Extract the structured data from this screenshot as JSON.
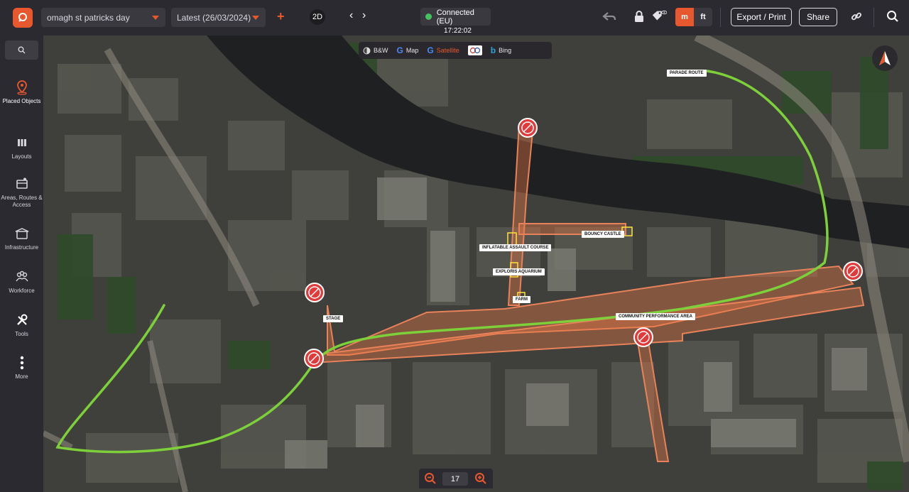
{
  "header": {
    "project_select": "omagh st patricks day",
    "version_select": "Latest (26/03/2024)",
    "view_mode": "2D",
    "connection_status": "Connected (EU)",
    "clock": "17:22:02",
    "unit_metric": "m",
    "unit_imperial": "ft",
    "export_label": "Export / Print",
    "share_label": "Share"
  },
  "sidebar": {
    "items": [
      {
        "label": "Placed Objects",
        "icon": "location-pin-icon"
      },
      {
        "label": "Layouts",
        "icon": "columns-icon"
      },
      {
        "label": "Areas, Routes & Access",
        "icon": "map-area-icon"
      },
      {
        "label": "Infrastructure",
        "icon": "tent-icon"
      },
      {
        "label": "Workforce",
        "icon": "people-icon"
      },
      {
        "label": "Tools",
        "icon": "wrench-icon"
      },
      {
        "label": "More",
        "icon": "more-dots-icon"
      }
    ]
  },
  "map": {
    "base_layers": [
      {
        "label": "B&W"
      },
      {
        "label": "Map"
      },
      {
        "label": "Satellite",
        "active": true
      },
      {
        "label": "Ordnance Survey"
      },
      {
        "label": "Bing"
      }
    ],
    "labels": {
      "parade_route": "PARADE ROUTE",
      "bouncy_castle": "BOUNCY CASTLE",
      "assault_course": "INFLATABLE ASSAULT COURSE",
      "aquarium": "EXPLORIS AQUARIUM",
      "farm": "FARM",
      "stage": "STAGE",
      "community_area": "COMMUNITY PERFORMANCE AREA"
    },
    "zoom_level": "17"
  },
  "colors": {
    "accent": "#e8582f",
    "route": "#7ed03a",
    "closure": "#e03a3a"
  }
}
